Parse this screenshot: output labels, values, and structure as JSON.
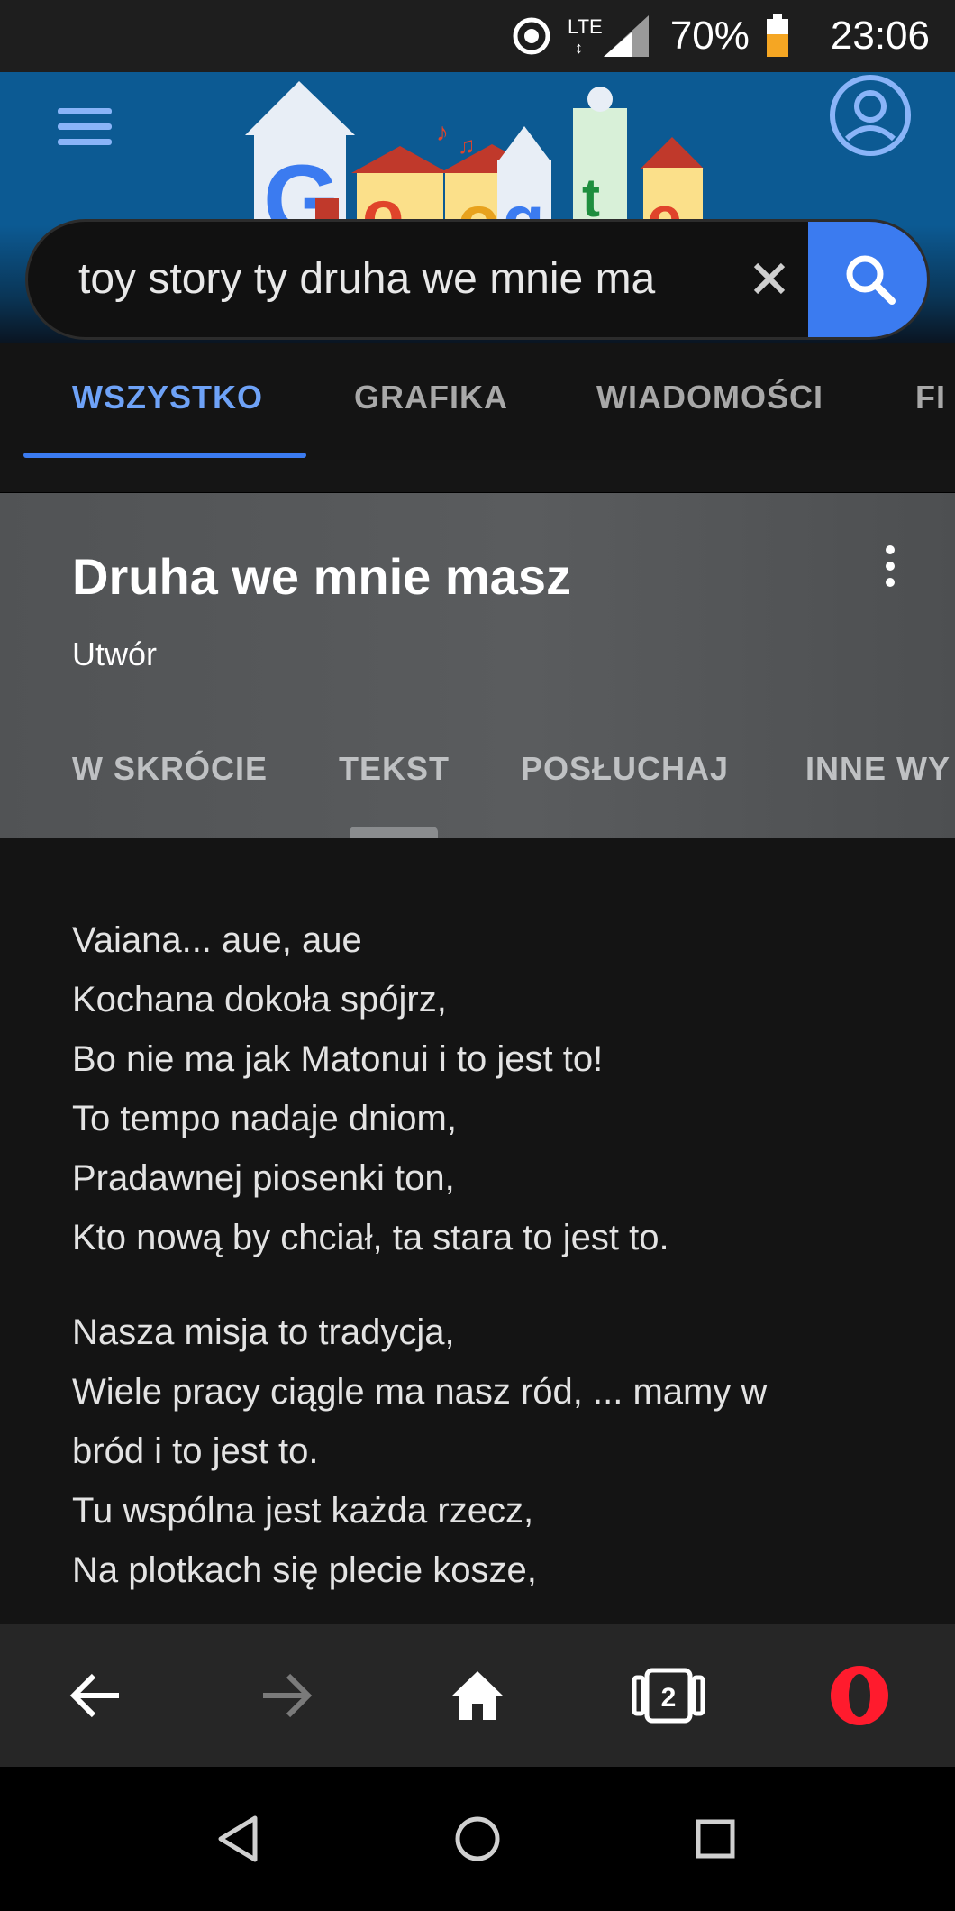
{
  "status_bar": {
    "network": "LTE",
    "battery": "70%",
    "time": "23:06"
  },
  "search": {
    "query": "toy story ty druha we mnie ma"
  },
  "tabs": [
    {
      "label": "WSZYSTKO",
      "active": true
    },
    {
      "label": "GRAFIKA",
      "active": false
    },
    {
      "label": "WIADOMOŚCI",
      "active": false
    },
    {
      "label": "FI",
      "active": false
    }
  ],
  "card": {
    "title": "Druha we mnie masz",
    "subtitle": "Utwór",
    "sub_tabs": [
      "W SKRÓCIE",
      "TEKST",
      "POSŁUCHAJ",
      "INNE WY"
    ]
  },
  "lyrics": {
    "stanza1": [
      "Vaiana... aue, aue",
      "Kochana dokoła spójrz,",
      "Bo nie ma jak Matonui i to jest to!",
      "To tempo nadaje dniom,",
      "Pradawnej piosenki ton,",
      "Kto nową by chciał, ta stara to jest to."
    ],
    "stanza2": [
      "Nasza misja to tradycja,",
      "Wiele pracy ciągle ma nasz ród, ... mamy w",
      "bród i to jest to.",
      "Tu wspólna jest każda rzecz,",
      "Na plotkach się plecie kosze,"
    ]
  },
  "browser_bar": {
    "tab_count": "2"
  },
  "colors": {
    "accent": "#3b7bf0",
    "active_tab": "#6ea2f7",
    "header_blue": "#0c5a93",
    "opera_red": "#ff1b2d"
  }
}
